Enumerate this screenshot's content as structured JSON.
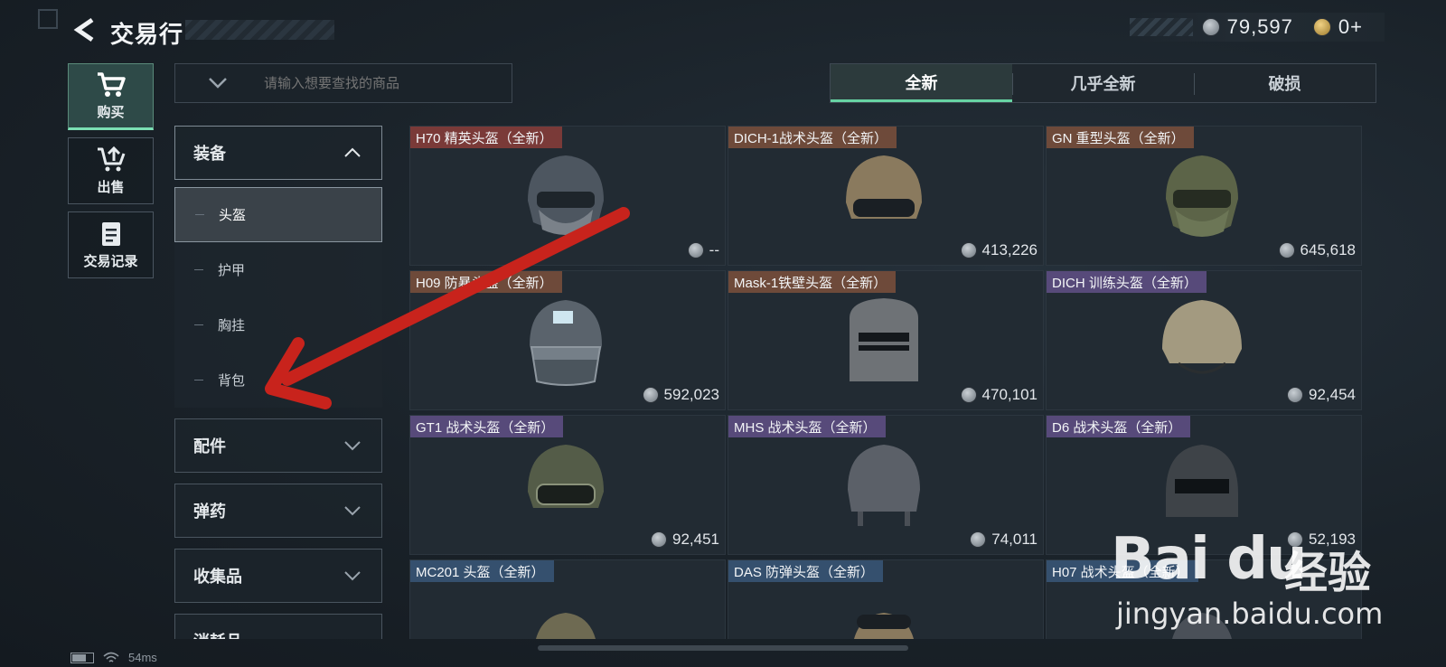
{
  "header": {
    "title": "交易行",
    "currency": [
      {
        "icon": "silver-coin-icon",
        "value": "79,597"
      },
      {
        "icon": "gold-coin-icon",
        "value": "0+"
      }
    ]
  },
  "side_nav": [
    {
      "label": "购买",
      "icon": "cart-icon",
      "active": true
    },
    {
      "label": "出售",
      "icon": "sell-icon",
      "active": false
    },
    {
      "label": "交易记录",
      "icon": "record-icon",
      "active": false
    }
  ],
  "search": {
    "placeholder": "请输入想要查找的商品"
  },
  "tabs": [
    {
      "label": "全新",
      "active": true
    },
    {
      "label": "几乎全新",
      "active": false
    },
    {
      "label": "破损",
      "active": false
    }
  ],
  "categories": {
    "equipment": {
      "label": "装备",
      "subs": [
        {
          "label": "头盔",
          "active": true
        },
        {
          "label": "护甲",
          "active": false
        },
        {
          "label": "胸挂",
          "active": false
        },
        {
          "label": "背包",
          "active": false
        }
      ]
    },
    "others": [
      {
        "label": "配件"
      },
      {
        "label": "弹药"
      },
      {
        "label": "收集品"
      },
      {
        "label": "消耗品"
      }
    ]
  },
  "items": [
    {
      "name": "H70 精英头盔（全新）",
      "price": "--",
      "tag_color": "#7a3a38"
    },
    {
      "name": "DICH-1战术头盔（全新）",
      "price": "413,226",
      "tag_color": "#6e4a3a"
    },
    {
      "name": "GN 重型头盔（全新）",
      "price": "645,618",
      "tag_color": "#6e4a3a"
    },
    {
      "name": "H09 防暴头盔（全新）",
      "price": "592,023",
      "tag_color": "#6e4a3a"
    },
    {
      "name": "Mask-1铁壁头盔（全新）",
      "price": "470,101",
      "tag_color": "#6e4a3a"
    },
    {
      "name": "DICH 训练头盔（全新）",
      "price": "92,454",
      "tag_color": "#574a7a"
    },
    {
      "name": "GT1 战术头盔（全新）",
      "price": "92,451",
      "tag_color": "#574a7a"
    },
    {
      "name": "MHS 战术头盔（全新）",
      "price": "74,011",
      "tag_color": "#574a7a"
    },
    {
      "name": "D6 战术头盔（全新）",
      "price": "52,193",
      "tag_color": "#574a7a"
    },
    {
      "name": "MC201 头盔（全新）",
      "price": "",
      "tag_color": "#35506e"
    },
    {
      "name": "DAS 防弹头盔（全新）",
      "price": "",
      "tag_color": "#35506e"
    },
    {
      "name": "H07 战术头盔（全新）",
      "price": "",
      "tag_color": "#35506e"
    }
  ],
  "status_bar": {
    "ping": "54ms"
  },
  "watermark": {
    "brand": "Bai du",
    "suffix": "经验",
    "url": "jingyan.baidu.com"
  }
}
